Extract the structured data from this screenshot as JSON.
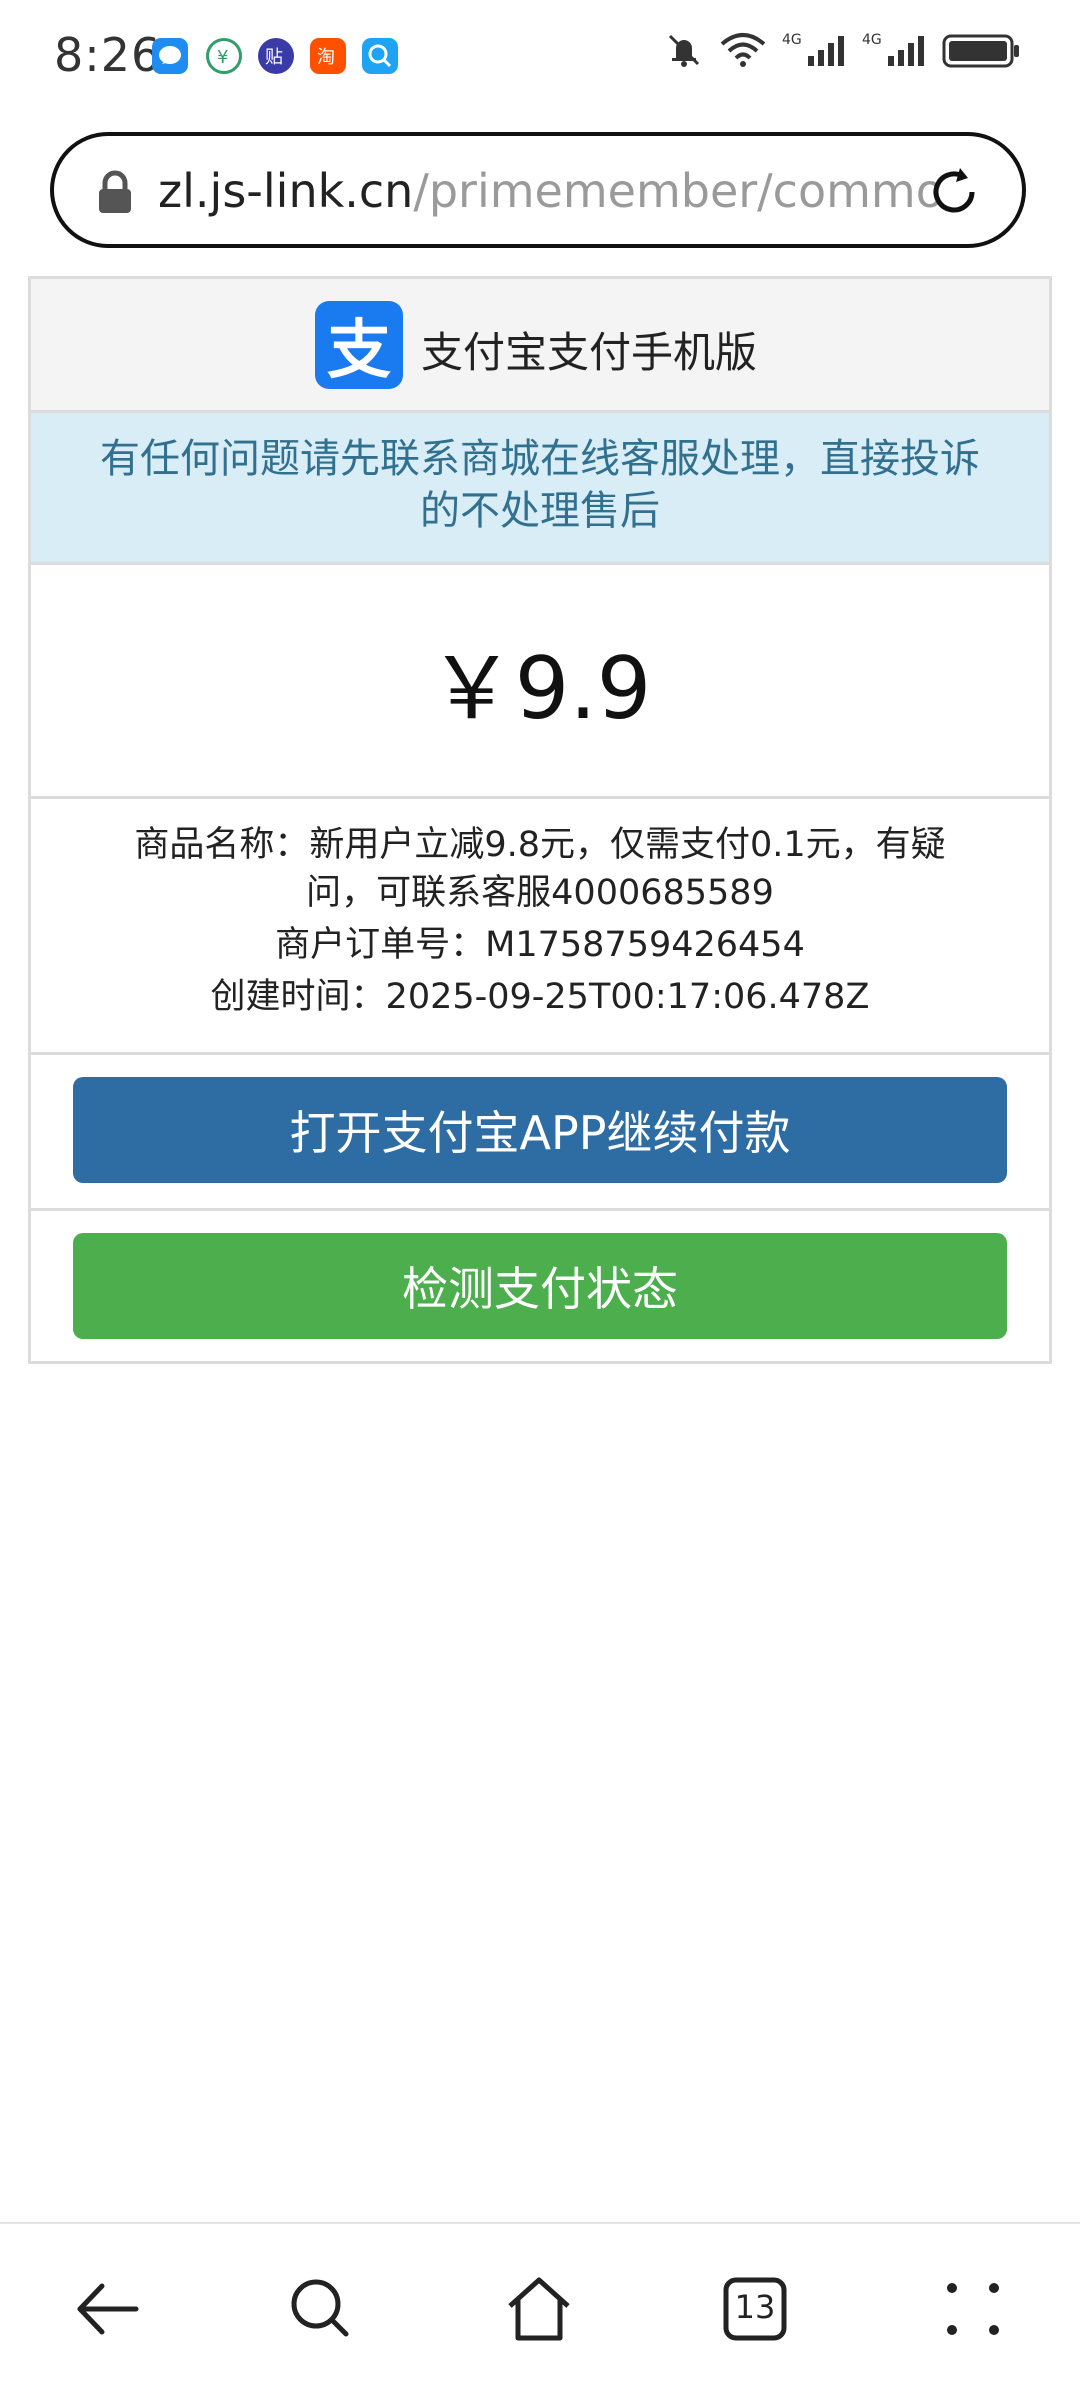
{
  "status_bar": {
    "time": "8:26",
    "icons": [
      "notification-bubble-icon",
      "app-icon",
      "app-icon",
      "taobao-icon",
      "search-app-icon"
    ],
    "right_icons": [
      "mute-bell-icon",
      "wifi-icon",
      "signal-4g-icon",
      "signal-4g-icon",
      "battery-icon"
    ],
    "network_label": "4G"
  },
  "browser": {
    "url_host": "zl.js-link.cn",
    "url_path": "/primemember/commo"
  },
  "pay_page": {
    "header_title": "支付宝支付手机版",
    "logo_char": "支",
    "notice": "有任何问题请先联系商城在线客服处理，直接投诉的不处理售后",
    "amount": "￥9.9",
    "product_name": "商品名称：新用户立减9.8元，仅需支付0.1元，有疑问，可联系客服4000685589",
    "order_no": "商户订单号：M1758759426454",
    "created_time": "创建时间：2025-09-25T00:17:06.478Z",
    "open_app_button": "打开支付宝APP继续付款",
    "check_status_button": "检测支付状态"
  },
  "bottom_nav": {
    "tab_count": "13"
  },
  "colors": {
    "alipay_blue": "#1a7bf0",
    "notice_bg": "#d9edf7",
    "notice_text": "#31708f",
    "open_button": "#2e6da4",
    "check_button": "#4cae4c"
  }
}
